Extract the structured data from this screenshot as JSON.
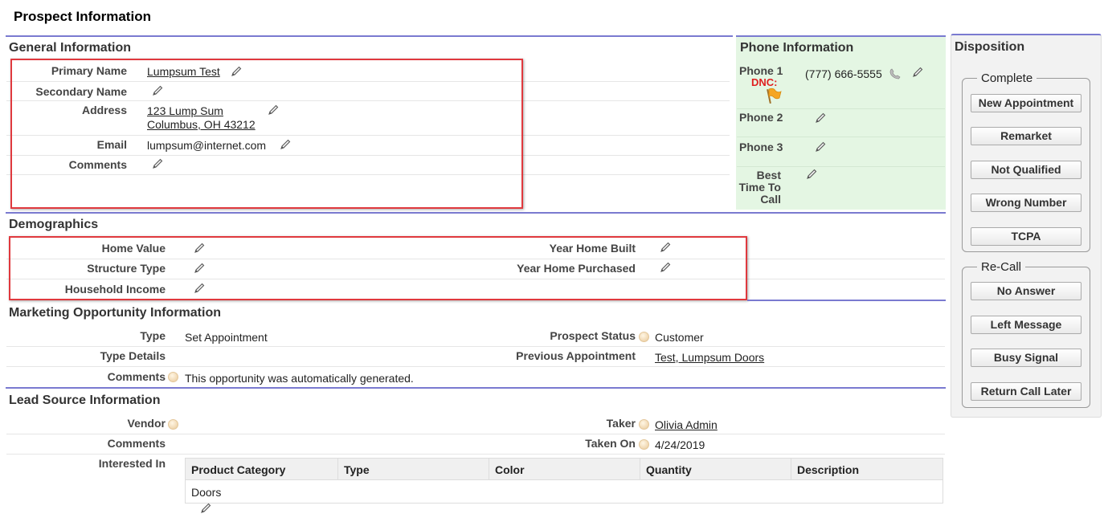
{
  "page_title": "Prospect Information",
  "general": {
    "title": "General Information",
    "primary_name_label": "Primary Name",
    "primary_name_value": "Lumpsum Test",
    "secondary_name_label": "Secondary Name",
    "address_label": "Address",
    "address_line1": "123 Lump Sum",
    "address_line2": "Columbus, OH 43212",
    "email_label": "Email",
    "email_value": "lumpsum@internet.com",
    "comments_label": "Comments"
  },
  "phone": {
    "title": "Phone Information",
    "phone1_label": "Phone 1",
    "dnc_label": "DNC:",
    "phone1_value": "(777) 666-5555",
    "phone2_label": "Phone 2",
    "phone3_label": "Phone 3",
    "best_time_line1": "Best",
    "best_time_line2": "Time To",
    "best_time_line3": "Call"
  },
  "demographics": {
    "title": "Demographics",
    "home_value_label": "Home Value",
    "structure_type_label": "Structure Type",
    "household_income_label": "Household Income",
    "year_built_label": "Year Home Built",
    "year_purchased_label": "Year Home Purchased"
  },
  "marketing": {
    "title": "Marketing Opportunity Information",
    "type_label": "Type",
    "type_value": "Set Appointment",
    "type_details_label": "Type Details",
    "comments_label": "Comments",
    "comments_value": "This opportunity was automatically generated.",
    "prospect_status_label": "Prospect Status",
    "prospect_status_value": "Customer",
    "previous_appt_label": "Previous Appointment",
    "previous_appt_value": "Test, Lumpsum Doors"
  },
  "lead_source": {
    "title": "Lead Source Information",
    "vendor_label": "Vendor",
    "comments_label": "Comments",
    "interested_label": "Interested In",
    "taker_label": "Taker",
    "taker_value": "Olivia Admin",
    "taken_on_label": "Taken On",
    "taken_on_value": "4/24/2019",
    "table_headers": [
      "Product Category",
      "Type",
      "Color",
      "Quantity",
      "Description"
    ],
    "table_rows": [
      [
        "Doors",
        "",
        "",
        "",
        ""
      ]
    ]
  },
  "disposition": {
    "title": "Disposition",
    "complete_legend": "Complete",
    "complete_buttons": [
      "New Appointment",
      "Remarket",
      "Not Qualified",
      "Wrong Number",
      "TCPA"
    ],
    "recall_legend": "Re-Call",
    "recall_buttons": [
      "No Answer",
      "Left Message",
      "Busy Signal",
      "Return Call Later"
    ]
  },
  "colors": {
    "section_rule": "#7a7ad0",
    "highlight_box": "#e0393e",
    "phone_panel_bg": "#e4f6e3",
    "dnc_text": "#e02020",
    "flag": "#f5a623"
  },
  "icons": [
    "pencil-icon",
    "phone-icon",
    "dnc-flag-icon",
    "info-icon"
  ]
}
